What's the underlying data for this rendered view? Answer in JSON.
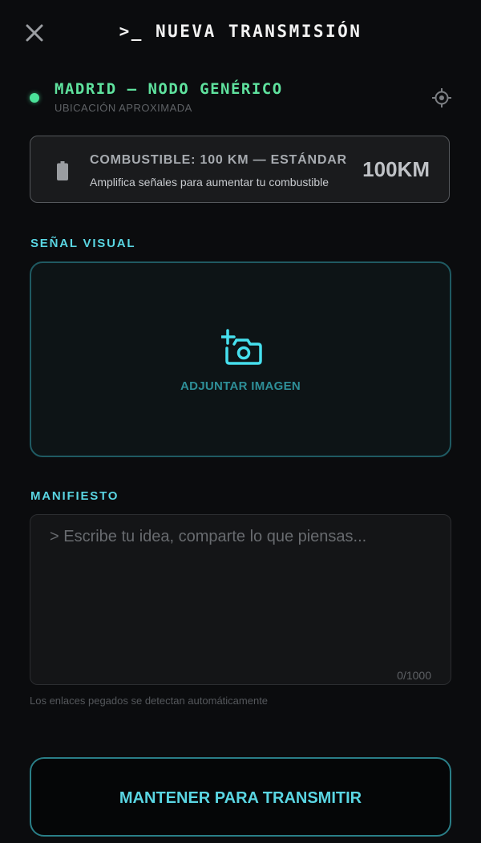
{
  "header": {
    "title": ">_ NUEVA TRANSMISIÓN",
    "close_icon": "close-icon"
  },
  "location": {
    "name": "MADRID — NODO GENÉRICO",
    "subtitle": "UBICACIÓN APROXIMADA",
    "status_color": "#4be39a",
    "gps_icon": "crosshair-icon"
  },
  "fuel": {
    "title": "COMBUSTIBLE: 100 KM — ESTÁNDAR",
    "subtitle": "Amplifica señales para aumentar tu combustible",
    "value": "100KM",
    "icon": "battery-icon"
  },
  "visual_signal": {
    "label": "SEÑAL VISUAL",
    "attach_label": "ADJUNTAR IMAGEN",
    "icon": "add-photo-icon"
  },
  "manifest": {
    "label": "MANIFIESTO",
    "placeholder": "> Escribe tu idea, comparte lo que piensas...",
    "value": "",
    "char_count": "0/1000"
  },
  "hint": "Los enlaces pegados se detectan automáticamente",
  "transmit_button": {
    "label": "MANTENER PARA TRANSMITIR"
  },
  "colors": {
    "accent": "#5ad6e3",
    "location_green": "#5fe29e",
    "background": "#0b0c0e"
  }
}
